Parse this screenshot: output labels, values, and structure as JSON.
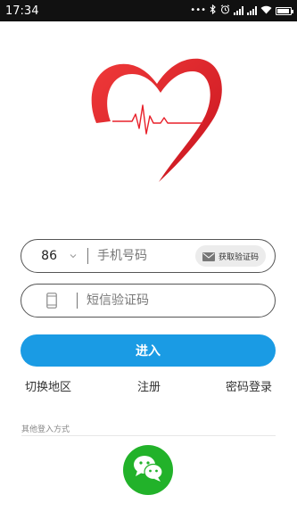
{
  "status_bar": {
    "time": "17:34",
    "icons": [
      "dots-icon",
      "bluetooth-icon",
      "alarm-icon",
      "signal-icon",
      "signal-icon",
      "wifi-icon",
      "battery-icon"
    ]
  },
  "logo": {
    "icon": "heart-ecg-logo",
    "colors": {
      "primary": "#e8202a"
    }
  },
  "login_form": {
    "country_code": "86",
    "phone_placeholder": "手机号码",
    "get_code_label": "获取验证码",
    "sms_code_placeholder": "短信验证码"
  },
  "login_button": {
    "label": "进入",
    "color": "#1a9be4"
  },
  "links": {
    "switch_region": "切换地区",
    "register": "注册",
    "password_login": "密码登录"
  },
  "other_login": {
    "label": "其他登入方式",
    "wechat": {
      "icon": "wechat-icon",
      "color": "#22b22a"
    }
  }
}
